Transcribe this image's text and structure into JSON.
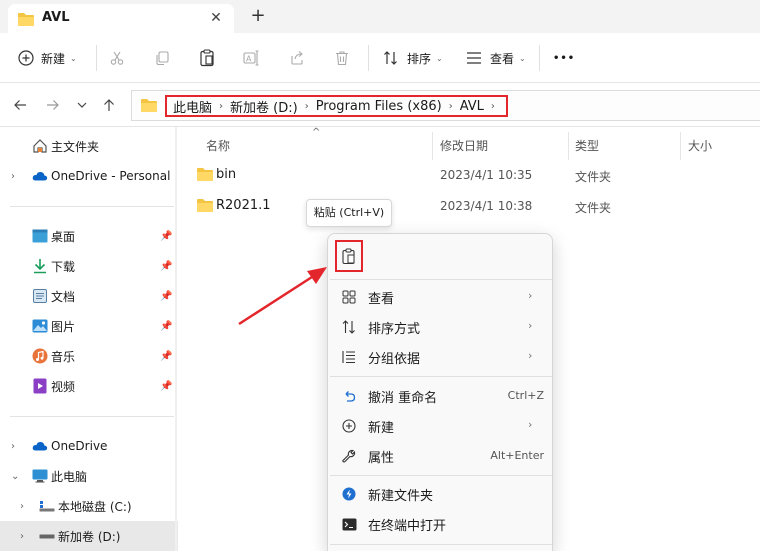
{
  "tab": {
    "title": "AVL",
    "close_glyph": "✕",
    "new_tab_glyph": "+"
  },
  "toolbar": {
    "new_label": "新建",
    "sort_label": "排序",
    "view_label": "查看",
    "more_glyph": "•••",
    "icons": [
      "new-icon",
      "cut-icon",
      "copy-icon",
      "paste-icon",
      "rename-icon",
      "share-icon",
      "delete-icon",
      "sort-icon",
      "view-icon",
      "more-icon"
    ]
  },
  "address": {
    "crumbs": [
      "此电脑",
      "新加卷 (D:)",
      "Program Files (x86)",
      "AVL"
    ],
    "chevron": "›"
  },
  "sidebar": {
    "home": "主文件夹",
    "onedrive_personal": "OneDrive - Personal",
    "quick": [
      {
        "label": "桌面",
        "icon": "desktop-icon"
      },
      {
        "label": "下载",
        "icon": "download-icon"
      },
      {
        "label": "文档",
        "icon": "document-icon"
      },
      {
        "label": "图片",
        "icon": "pictures-icon"
      },
      {
        "label": "音乐",
        "icon": "music-icon"
      },
      {
        "label": "视频",
        "icon": "video-icon"
      }
    ],
    "onedrive": "OneDrive",
    "this_pc": "此电脑",
    "drive_c": "本地磁盘 (C:)",
    "drive_d": "新加卷 (D:)"
  },
  "columns": {
    "name": "名称",
    "modified": "修改日期",
    "type": "类型",
    "size": "大小"
  },
  "files": [
    {
      "name": "bin",
      "modified": "2023/4/1 10:35",
      "type": "文件夹"
    },
    {
      "name": "R2021.1",
      "modified": "2023/4/1 10:38",
      "type": "文件夹"
    }
  ],
  "tooltip": "粘贴 (Ctrl+V)",
  "context_menu": {
    "view": "查看",
    "sort_by": "排序方式",
    "group_by": "分组依据",
    "undo": "撤消 重命名",
    "undo_key": "Ctrl+Z",
    "new": "新建",
    "properties": "属性",
    "properties_key": "Alt+Enter",
    "new_folder": "新建文件夹",
    "open_terminal": "在终端中打开",
    "submenu_arrow": "›"
  },
  "colors": {
    "highlight_red": "#e3262c",
    "folder_yellow": "#f4c542",
    "onedrive_blue": "#0a64c8"
  }
}
